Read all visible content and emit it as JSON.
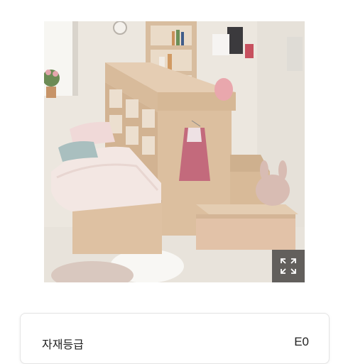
{
  "product_image": {
    "alt": "",
    "expand_icon": "expand-icon"
  },
  "spec": {
    "label": "자재등급",
    "value": "E0"
  },
  "colors": {
    "wood": "#dcbf9f",
    "wall": "#ece6dd",
    "floor": "#e9e4dc",
    "bedding": "#f4e7e4"
  }
}
